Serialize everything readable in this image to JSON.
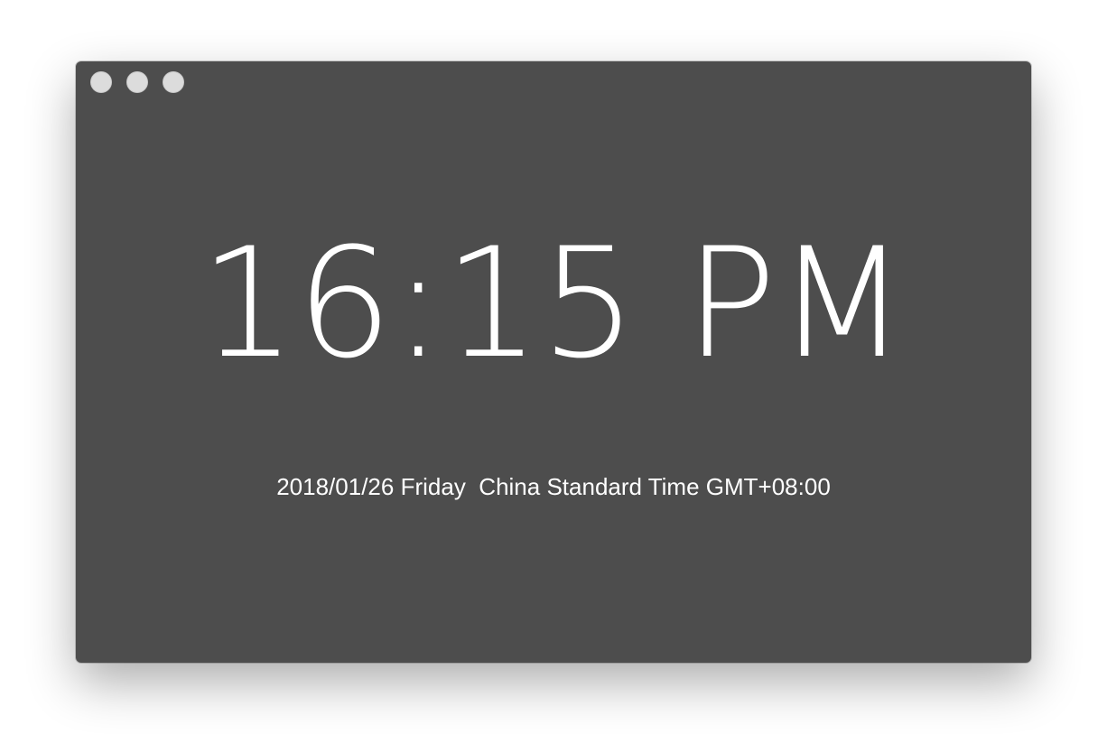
{
  "window": {
    "background_color": "#4d4d4d",
    "traffic_lights": [
      {
        "name": "close",
        "color": "#dcdcdc"
      },
      {
        "name": "minimize",
        "color": "#dcdcdc"
      },
      {
        "name": "zoom",
        "color": "#dcdcdc"
      }
    ]
  },
  "clock": {
    "time": "16:15 PM",
    "date": "2018/01/26",
    "weekday": "Friday",
    "timezone": "China Standard Time GMT+08:00"
  }
}
